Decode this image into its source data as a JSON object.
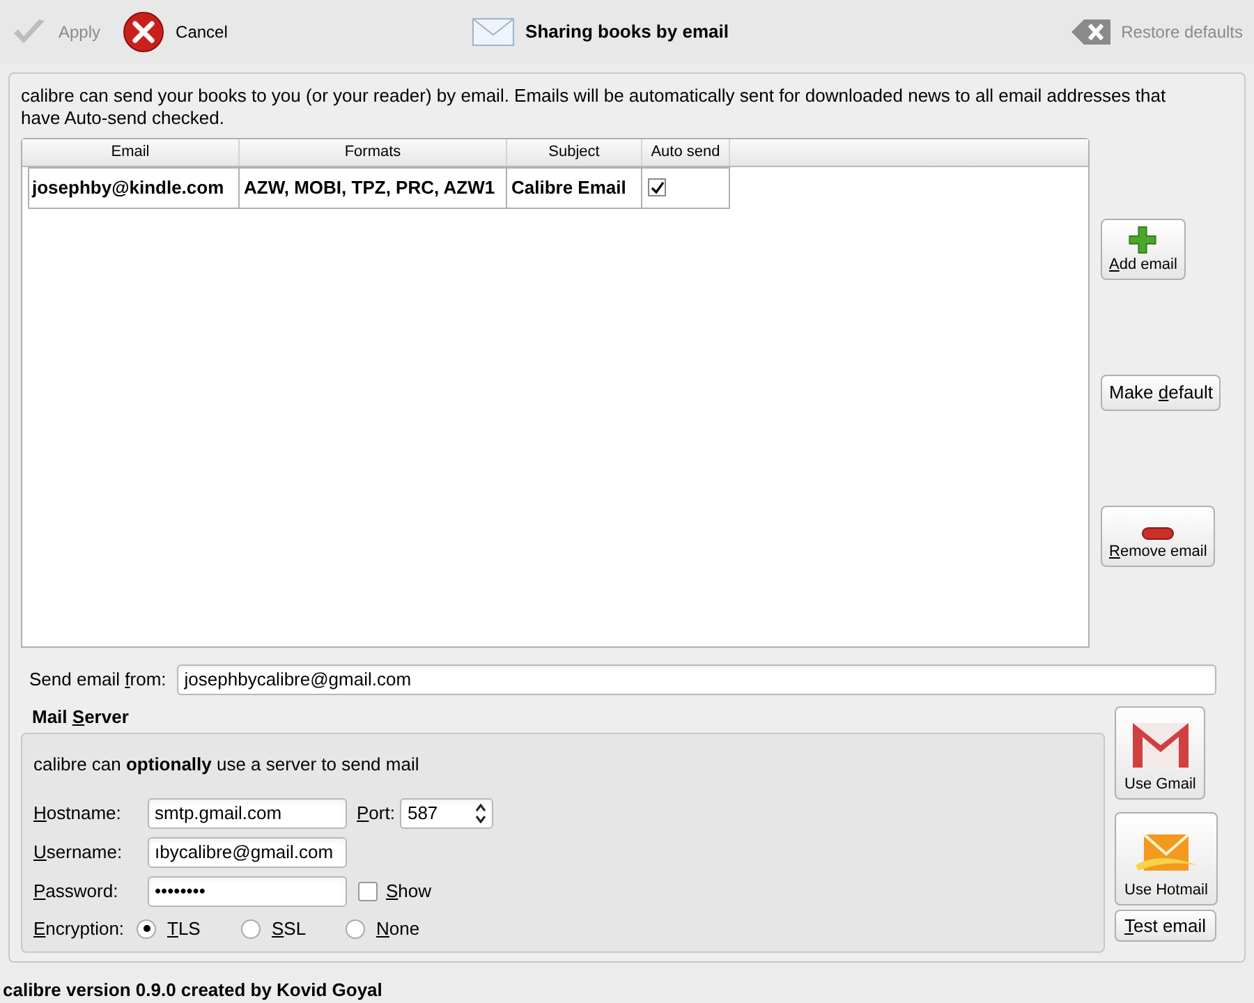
{
  "toolbar": {
    "apply": {
      "label": "Apply",
      "disabled": true
    },
    "cancel": {
      "label": "Cancel"
    },
    "title": "Sharing books by email",
    "restore": {
      "label": "Restore defaults",
      "disabled": true
    }
  },
  "intro": "calibre can send your books to you (or your reader) by email. Emails will be automatically sent for downloaded news to all email addresses that have Auto-send checked.",
  "table": {
    "columns": [
      "Email",
      "Formats",
      "Subject",
      "Auto send"
    ],
    "rows": [
      {
        "email": "josephby@kindle.com",
        "formats": "AZW, MOBI, TPZ, PRC, AZW1",
        "subject": "Calibre Email",
        "auto_send": true
      }
    ]
  },
  "side_buttons": [
    {
      "kind": "add",
      "label": {
        "key": "A",
        "after": "dd email"
      }
    },
    {
      "kind": "default",
      "label": {
        "before": "Make ",
        "key": "d",
        "after": "efault"
      }
    },
    {
      "kind": "remove",
      "label": {
        "key": "R",
        "after": "emove email"
      }
    }
  ],
  "send_from": {
    "label": {
      "before": "Send email ",
      "key": "f",
      "after": "rom:"
    },
    "value": "josephbycalibre@gmail.com"
  },
  "mail_server": {
    "title": {
      "before": "Mail ",
      "key": "S",
      "after": "erver"
    },
    "intro": "calibre can **optionally** use a server to send mail",
    "hostname": {
      "label": {
        "key": "H",
        "after": "ostname:"
      },
      "value": "smtp.gmail.com"
    },
    "port": {
      "label": {
        "key": "P",
        "after": "ort:"
      },
      "value": "587"
    },
    "username": {
      "label": {
        "key": "U",
        "after": "sername:"
      },
      "value": "ıbycalibre@gmail.com"
    },
    "password": {
      "label": {
        "key": "P",
        "after": "assword:"
      },
      "value": "••••••••"
    },
    "show": {
      "label": {
        "key": "S",
        "after": "how"
      },
      "checked": false
    },
    "encryption": {
      "label": {
        "key": "E",
        "after": "ncryption:"
      },
      "options": [
        {
          "label": {
            "key": "T",
            "after": "LS"
          },
          "selected": true
        },
        {
          "label": {
            "key": "S",
            "after": "SL"
          },
          "selected": false
        },
        {
          "label": {
            "key": "N",
            "after": "one"
          },
          "selected": false
        }
      ]
    }
  },
  "service_buttons": [
    {
      "kind": "gmail",
      "label": {
        "before": "Use Gmail"
      }
    },
    {
      "kind": "hotmail",
      "label": {
        "before": "Use Hotmail"
      }
    },
    {
      "kind": "test",
      "label": {
        "key": "T",
        "after": "est email"
      }
    }
  ],
  "footer": "calibre version 0.9.0 created by Kovid Goyal"
}
